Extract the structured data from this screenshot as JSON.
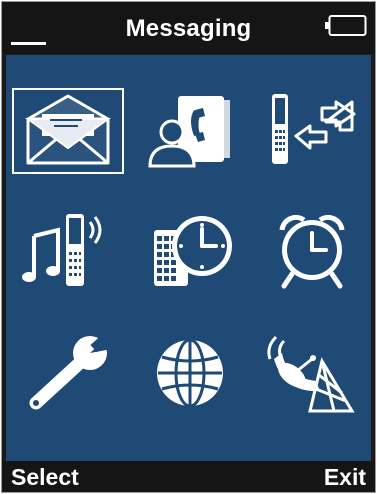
{
  "header": {
    "title": "Messaging"
  },
  "status": {
    "battery": "battery-icon",
    "signal": "signal-indicator"
  },
  "grid": {
    "selected_index": 0,
    "items": [
      {
        "icon": "envelope-icon"
      },
      {
        "icon": "contacts-phonebook-icon"
      },
      {
        "icon": "phone-transfer-icon"
      },
      {
        "icon": "music-phone-icon"
      },
      {
        "icon": "calendar-clock-icon"
      },
      {
        "icon": "alarm-clock-icon"
      },
      {
        "icon": "wrench-icon"
      },
      {
        "icon": "globe-icon"
      },
      {
        "icon": "satellite-dish-icon"
      }
    ]
  },
  "softkeys": {
    "left": "Select",
    "right": "Exit"
  },
  "colors": {
    "background": "#1f4a75",
    "bars": "#151515",
    "icon": "#ffffff"
  }
}
